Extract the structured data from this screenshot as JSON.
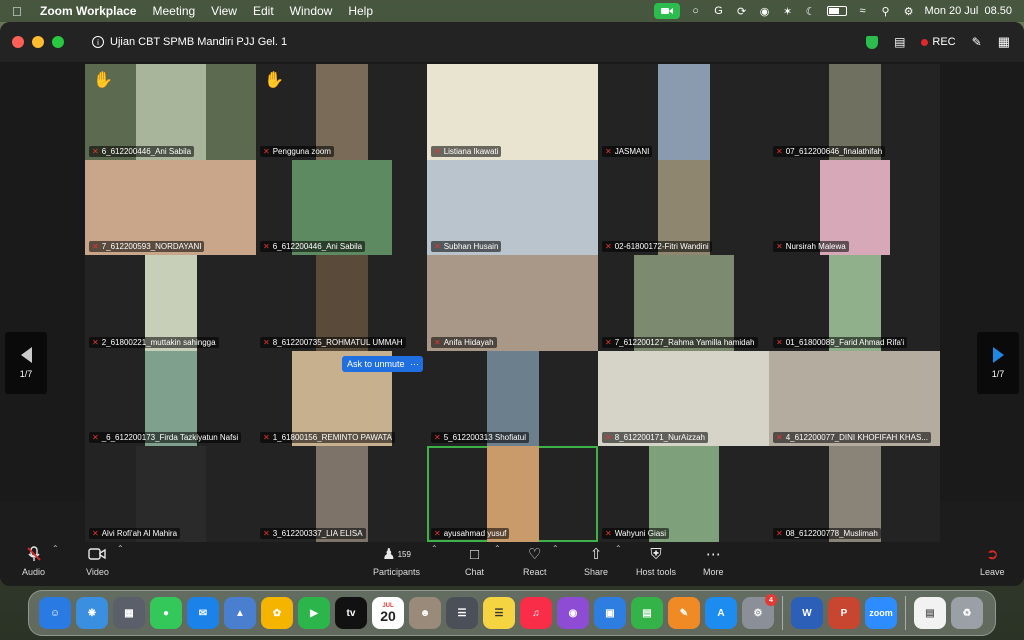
{
  "menubar": {
    "app_name": "Zoom Workplace",
    "menus": [
      "Meeting",
      "View",
      "Edit",
      "Window",
      "Help"
    ],
    "datetime": "Mon 20 Jul  08.50"
  },
  "window": {
    "meeting_title": "Ujian CBT SPMB Mandiri PJJ Gel. 1",
    "rec_label": "REC"
  },
  "gallery": {
    "page_left": "1/7",
    "page_right": "1/7",
    "tooltip": "Ask to unmute",
    "tooltip_more": "···",
    "tiles": [
      {
        "name": "6_612200446_Ani Sabila",
        "hand": true,
        "bg": "#5c6a4f",
        "video": "#a8b59a",
        "w": "half"
      },
      {
        "name": "Pengguna zoom",
        "hand": true,
        "bg": "#232323",
        "video": "#7a6a58",
        "w": ""
      },
      {
        "name": "Listiana Ikawati",
        "hand": false,
        "bg": "#e9e4cf",
        "video": "#e9e4cf",
        "w": "wide"
      },
      {
        "name": "JASMANI",
        "hand": false,
        "bg": "#232323",
        "video": "#8a9bb0",
        "w": ""
      },
      {
        "name": "07_612200646_finalathifah",
        "hand": false,
        "bg": "#232323",
        "video": "#707060",
        "w": ""
      },
      {
        "name": "7_612200593_NORDAYANI",
        "hand": false,
        "bg": "#c9a68a",
        "video": "#c9a68a",
        "w": "wide"
      },
      {
        "name": "6_612200446_Ani Sabila",
        "hand": false,
        "bg": "#232323",
        "video": "#5e8a62",
        "w": "mid"
      },
      {
        "name": "Subhan Husain",
        "hand": false,
        "bg": "#b9c4cc",
        "video": "#b9c4cc",
        "w": "wide"
      },
      {
        "name": "02-61800172-Fitri Wandini",
        "hand": false,
        "bg": "#232323",
        "video": "#8f8670",
        "w": ""
      },
      {
        "name": "Nursirah Malewa",
        "hand": false,
        "bg": "#232323",
        "video": "#d6a8b8",
        "w": "half"
      },
      {
        "name": "2_61800221_muttakin sahingga",
        "hand": false,
        "bg": "#232323",
        "video": "#c8cfb8",
        "w": ""
      },
      {
        "name": "8_612200735_ROHMATUL UMMAH",
        "hand": false,
        "bg": "#232323",
        "video": "#5a4a3a",
        "w": ""
      },
      {
        "name": "Anifa Hidayah",
        "hand": false,
        "bg": "#a99888",
        "video": "#a99888",
        "w": "wide"
      },
      {
        "name": "7_612200127_Rahma Yamilla hamidah",
        "hand": false,
        "bg": "#232323",
        "video": "#7c8a70",
        "w": "mid"
      },
      {
        "name": "01_61800089_Farid Ahmad Rifa'i",
        "hand": false,
        "bg": "#232323",
        "video": "#8fb08a",
        "w": ""
      },
      {
        "name": "_6_612200173_Firda Tazkiyatun Nafsi",
        "hand": false,
        "bg": "#232323",
        "video": "#7fa08c",
        "w": ""
      },
      {
        "name": "1_61800156_REMINTO PAWATA",
        "hand": false,
        "bg": "#232323",
        "video": "#c7b08e",
        "w": "mid"
      },
      {
        "name": "5_612200313 Shofiatul",
        "hand": false,
        "bg": "#232323",
        "video": "#6b7f8c",
        "w": ""
      },
      {
        "name": "8_612200171_NurAizzah",
        "hand": false,
        "bg": "#d6d3c8",
        "video": "#d6d3c8",
        "w": "wide"
      },
      {
        "name": "4_612200077_DINI KHOFIFAH KHAS...",
        "hand": false,
        "bg": "#b5aca0",
        "video": "#b5aca0",
        "w": "wide"
      },
      {
        "name": "Alvi Rofi'ah Al Mahira",
        "hand": false,
        "bg": "#232323",
        "video": "#2a2a2a",
        "w": "half"
      },
      {
        "name": "3_612200337_LIA ELISA",
        "hand": false,
        "bg": "#232323",
        "video": "#7d7368",
        "w": ""
      },
      {
        "name": "ayusahmad yusuf",
        "hand": false,
        "bg": "#232323",
        "video": "#c99a6a",
        "w": "",
        "active": true
      },
      {
        "name": "Wahyuni Giasi",
        "hand": false,
        "bg": "#232323",
        "video": "#7ea07a",
        "w": "half"
      },
      {
        "name": "08_612200778_Muslimah",
        "hand": false,
        "bg": "#232323",
        "video": "#8a8478",
        "w": ""
      }
    ]
  },
  "toolbar": {
    "audio": "Audio",
    "video": "Video",
    "participants": "Participants",
    "participants_count": "159",
    "chat": "Chat",
    "react": "React",
    "share": "Share",
    "host_tools": "Host tools",
    "more": "More",
    "leave": "Leave"
  },
  "dock": {
    "calendar_month": "JUL",
    "calendar_day": "20",
    "settings_badge": "4",
    "zoom_label": "zoom"
  },
  "colors": {
    "accent": "#1f6fe0",
    "active_speaker": "#3db24a",
    "leave": "#e02828"
  }
}
